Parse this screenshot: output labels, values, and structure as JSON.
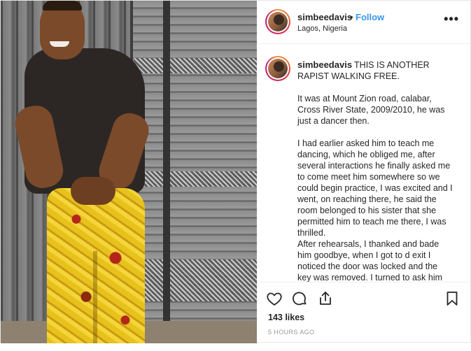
{
  "post": {
    "username": "simbeedavis",
    "separator": "•",
    "follow_label": "Follow",
    "location": "Lagos, Nigeria",
    "more_label": "•••",
    "likes": "143 likes",
    "timestamp": "5 HOURS AGO"
  },
  "caption": {
    "username": "simbeedavis",
    "paragraphs": [
      "THIS IS ANOTHER RAPIST WALKING FREE.",
      "It was at Mount Zion road, calabar, Cross River State, 2009/2010, he was just a dancer then.",
      "I had earlier asked him to teach me dancing, which he obliged me, after several interactions he finally asked me to come meet him somewhere so we could begin practice, I was excited and I went, on reaching there, he said the room belonged to his sister that she permitted him to teach me there, I was thrilled.",
      "After rehearsals, I thanked and bade him goodbye, when I got to d exit I noticed the door was locked and the key was removed. I turned to ask him"
    ]
  },
  "icons": {
    "like": "heart-icon",
    "comment": "comment-icon",
    "share": "share-icon",
    "save": "bookmark-icon",
    "more": "more-icon"
  },
  "colors": {
    "follow": "#3897f0",
    "text": "#262626",
    "muted": "#999999"
  }
}
